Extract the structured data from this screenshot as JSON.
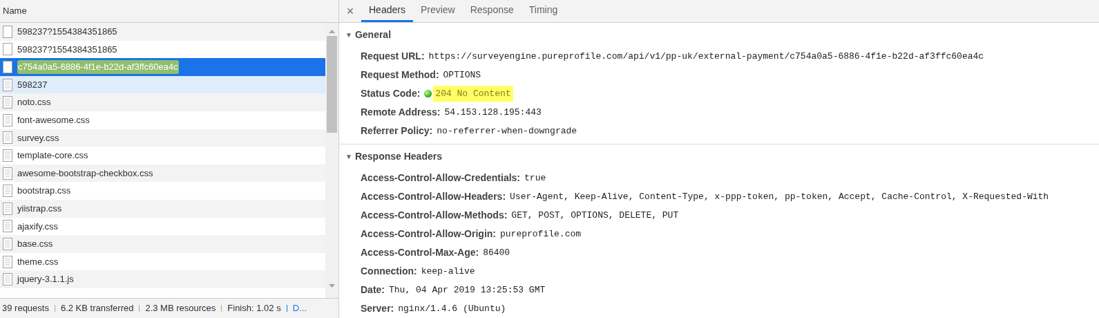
{
  "requests": {
    "column": "Name",
    "rows": [
      {
        "name": "598237?1554384351865",
        "kind": "blank",
        "selected": false,
        "hovered": false,
        "marked": false
      },
      {
        "name": "598237?1554384351865",
        "kind": "blank",
        "selected": false,
        "hovered": false,
        "marked": false
      },
      {
        "name": "c754a0a5-6886-4f1e-b22d-af3ffc60ea4c",
        "kind": "blank",
        "selected": true,
        "hovered": false,
        "marked": true
      },
      {
        "name": "598237",
        "kind": "text",
        "selected": false,
        "hovered": true,
        "marked": false
      },
      {
        "name": "noto.css",
        "kind": "text",
        "selected": false,
        "hovered": false,
        "marked": false
      },
      {
        "name": "font-awesome.css",
        "kind": "text",
        "selected": false,
        "hovered": false,
        "marked": false
      },
      {
        "name": "survey.css",
        "kind": "text",
        "selected": false,
        "hovered": false,
        "marked": false
      },
      {
        "name": "template-core.css",
        "kind": "text",
        "selected": false,
        "hovered": false,
        "marked": false
      },
      {
        "name": "awesome-bootstrap-checkbox.css",
        "kind": "text",
        "selected": false,
        "hovered": false,
        "marked": false
      },
      {
        "name": "bootstrap.css",
        "kind": "text",
        "selected": false,
        "hovered": false,
        "marked": false
      },
      {
        "name": "yiistrap.css",
        "kind": "text",
        "selected": false,
        "hovered": false,
        "marked": false
      },
      {
        "name": "ajaxify.css",
        "kind": "text",
        "selected": false,
        "hovered": false,
        "marked": false
      },
      {
        "name": "base.css",
        "kind": "text",
        "selected": false,
        "hovered": false,
        "marked": false
      },
      {
        "name": "theme.css",
        "kind": "text",
        "selected": false,
        "hovered": false,
        "marked": false
      },
      {
        "name": "jquery-3.1.1.js",
        "kind": "text",
        "selected": false,
        "hovered": false,
        "marked": false
      }
    ]
  },
  "status_bar": [
    {
      "text": "39 requests",
      "link": false
    },
    {
      "text": "6.2 KB transferred",
      "link": false
    },
    {
      "text": "2.3 MB resources",
      "link": false
    },
    {
      "text": "Finish: 1.02 s",
      "link": false
    },
    {
      "text": "D...",
      "link": true
    }
  ],
  "details": {
    "close": "×",
    "tabs": [
      {
        "label": "Headers",
        "selected": true
      },
      {
        "label": "Preview",
        "selected": false
      },
      {
        "label": "Response",
        "selected": false
      },
      {
        "label": "Timing",
        "selected": false
      }
    ],
    "sections": [
      {
        "title": "General",
        "expanded": true,
        "caret": "▼",
        "fields": [
          {
            "name": "Request URL:",
            "value": "https://surveyengine.pureprofile.com/api/v1/pp-uk/external-payment/c754a0a5-6886-4f1e-b22d-af3ffc60ea4c",
            "kind": "text",
            "marked": false
          },
          {
            "name": "Request Method:",
            "value": "OPTIONS",
            "kind": "text",
            "marked": false
          },
          {
            "name": "Status Code:",
            "value": "204 No Content",
            "kind": "status",
            "marked": true
          },
          {
            "name": "Remote Address:",
            "value": "54.153.128.195:443",
            "kind": "text",
            "marked": false
          },
          {
            "name": "Referrer Policy:",
            "value": "no-referrer-when-downgrade",
            "kind": "text",
            "marked": false
          }
        ]
      },
      {
        "title": "Response Headers",
        "expanded": true,
        "caret": "▼",
        "fields": [
          {
            "name": "Access-Control-Allow-Credentials:",
            "value": "true",
            "kind": "text",
            "marked": false
          },
          {
            "name": "Access-Control-Allow-Headers:",
            "value": "User-Agent, Keep-Alive, Content-Type, x-ppp-token, pp-token, Accept, Cache-Control, X-Requested-With",
            "kind": "text",
            "marked": false
          },
          {
            "name": "Access-Control-Allow-Methods:",
            "value": "GET, POST, OPTIONS, DELETE, PUT",
            "kind": "text",
            "marked": false
          },
          {
            "name": "Access-Control-Allow-Origin:",
            "value": "pureprofile.com",
            "kind": "text",
            "marked": false
          },
          {
            "name": "Access-Control-Max-Age:",
            "value": "86400",
            "kind": "text",
            "marked": false
          },
          {
            "name": "Connection:",
            "value": "keep-alive",
            "kind": "text",
            "marked": false
          },
          {
            "name": "Date:",
            "value": "Thu, 04 Apr 2019 13:25:53 GMT",
            "kind": "text",
            "marked": false
          },
          {
            "name": "Server:",
            "value": "nginx/1.4.6 (Ubuntu)",
            "kind": "text",
            "marked": false
          }
        ]
      }
    ]
  }
}
